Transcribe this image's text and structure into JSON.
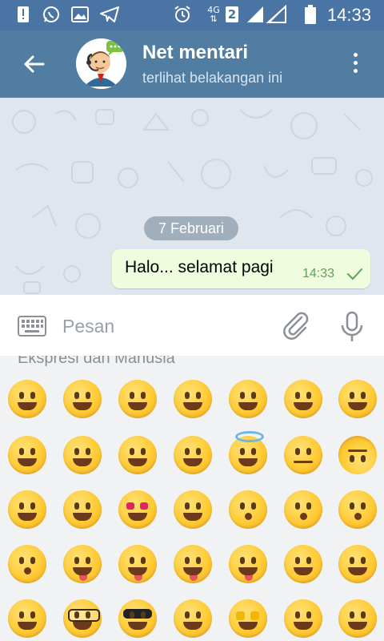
{
  "status_bar": {
    "time": "14:33",
    "network": "4G",
    "sim": "2",
    "icons": [
      "alert-icon",
      "whatsapp-icon",
      "image-icon",
      "telegram-icon",
      "alarm-icon",
      "network-icon",
      "signal-icon",
      "battery-icon"
    ]
  },
  "header": {
    "title": "Net mentari",
    "subtitle": "terlihat belakangan ini",
    "icons": [
      "back-arrow-icon",
      "avatar",
      "more-vert-icon"
    ]
  },
  "chat": {
    "date": "7 Februari",
    "messages": [
      {
        "text": "Halo... selamat pagi",
        "time": "14:33",
        "status": "read"
      }
    ]
  },
  "input": {
    "placeholder": "Pesan",
    "icons": [
      "keyboard-icon",
      "paperclip-icon",
      "microphone-icon"
    ]
  },
  "emoji_panel": {
    "section_title": "Ekspresi dan Manusia",
    "emojis": [
      "😀",
      "😃",
      "😄",
      "😁",
      "😆",
      "😅",
      "😂",
      "🤣",
      "🥲",
      "☺️",
      "😊",
      "😇",
      "🙂",
      "🙃",
      "😉",
      "😌",
      "😍",
      "🥰",
      "😘",
      "😗",
      "😙",
      "😚",
      "😋",
      "😛",
      "😝",
      "😜",
      "🤪",
      "🤨",
      "🧐",
      "🤓",
      "😎",
      "🥸",
      "🤩",
      "🥳",
      "😏"
    ]
  },
  "colors": {
    "header": "#527da3",
    "status_bar": "#4a74a4",
    "chat_bg": "#dfe6ee",
    "bubble": "#effdde",
    "check": "#5fa05a"
  }
}
